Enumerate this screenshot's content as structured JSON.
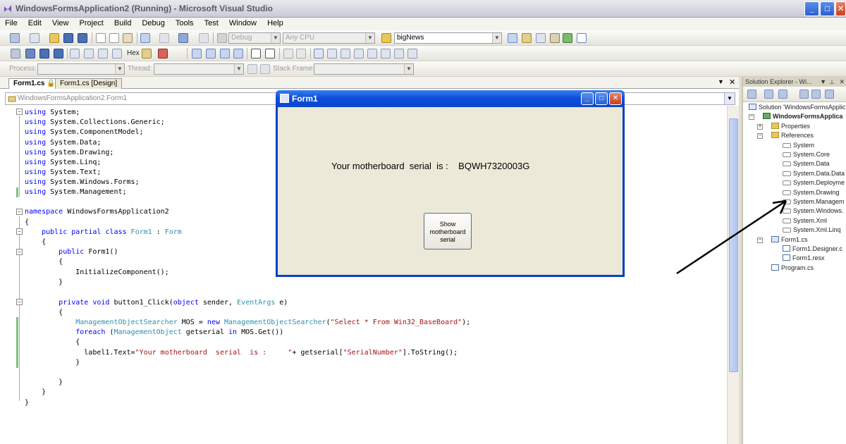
{
  "window": {
    "title": "WindowsFormsApplication2 (Running) - Microsoft Visual Studio",
    "min": "_",
    "max": "□",
    "close": "✕"
  },
  "menu": [
    "File",
    "Edit",
    "View",
    "Project",
    "Build",
    "Debug",
    "Tools",
    "Test",
    "Window",
    "Help"
  ],
  "toolbar": {
    "config": "Debug",
    "platform": "Any CPU",
    "find_value": "bigNews",
    "hex_label": "Hex",
    "process_label": "Process:",
    "thread_label": "Thread:",
    "stackframe_label": "Stack Frame:"
  },
  "tabs": [
    {
      "label": "Form1.cs",
      "active": true
    },
    {
      "label": "Form1.cs [Design]",
      "active": false
    }
  ],
  "type_dropdown": "WindowsFormsApplication2.Form1",
  "code": [
    [
      [
        "kw",
        "using"
      ],
      [
        "plain",
        " System;"
      ]
    ],
    [
      [
        "kw",
        "using"
      ],
      [
        "plain",
        " System.Collections.Generic;"
      ]
    ],
    [
      [
        "kw",
        "using"
      ],
      [
        "plain",
        " System.ComponentModel;"
      ]
    ],
    [
      [
        "kw",
        "using"
      ],
      [
        "plain",
        " System.Data;"
      ]
    ],
    [
      [
        "kw",
        "using"
      ],
      [
        "plain",
        " System.Drawing;"
      ]
    ],
    [
      [
        "kw",
        "using"
      ],
      [
        "plain",
        " System.Linq;"
      ]
    ],
    [
      [
        "kw",
        "using"
      ],
      [
        "plain",
        " System.Text;"
      ]
    ],
    [
      [
        "kw",
        "using"
      ],
      [
        "plain",
        " System.Windows.Forms;"
      ]
    ],
    [
      [
        "kw",
        "using"
      ],
      [
        "plain",
        " System.Management;"
      ]
    ],
    [],
    [
      [
        "kw",
        "namespace"
      ],
      [
        "plain",
        " WindowsFormsApplication2"
      ]
    ],
    [
      [
        "plain",
        "{"
      ]
    ],
    [
      [
        "plain",
        "    "
      ],
      [
        "kw",
        "public partial class"
      ],
      [
        "plain",
        " "
      ],
      [
        "ty",
        "Form1"
      ],
      [
        "plain",
        " : "
      ],
      [
        "ty",
        "Form"
      ]
    ],
    [
      [
        "plain",
        "    {"
      ]
    ],
    [
      [
        "plain",
        "        "
      ],
      [
        "kw",
        "public"
      ],
      [
        "plain",
        " Form1()"
      ]
    ],
    [
      [
        "plain",
        "        {"
      ]
    ],
    [
      [
        "plain",
        "            InitializeComponent();"
      ]
    ],
    [
      [
        "plain",
        "        }"
      ]
    ],
    [],
    [
      [
        "plain",
        "        "
      ],
      [
        "kw",
        "private void"
      ],
      [
        "plain",
        " button1_Click("
      ],
      [
        "kw",
        "object"
      ],
      [
        "plain",
        " sender, "
      ],
      [
        "ty",
        "EventArgs"
      ],
      [
        "plain",
        " e)"
      ]
    ],
    [
      [
        "plain",
        "        {"
      ]
    ],
    [
      [
        "plain",
        "            "
      ],
      [
        "ty",
        "ManagementObjectSearcher"
      ],
      [
        "plain",
        " MOS = "
      ],
      [
        "kw",
        "new"
      ],
      [
        "plain",
        " "
      ],
      [
        "ty",
        "ManagementObjectSearcher"
      ],
      [
        "plain",
        "("
      ],
      [
        "st",
        "\"Select * From Win32_BaseBoard\""
      ],
      [
        "plain",
        ");"
      ]
    ],
    [
      [
        "plain",
        "            "
      ],
      [
        "kw",
        "foreach"
      ],
      [
        "plain",
        " ("
      ],
      [
        "ty",
        "ManagementObject"
      ],
      [
        "plain",
        " getserial "
      ],
      [
        "kw",
        "in"
      ],
      [
        "plain",
        " MOS.Get())"
      ]
    ],
    [
      [
        "plain",
        "            {"
      ]
    ],
    [
      [
        "plain",
        "              label1.Text="
      ],
      [
        "st",
        "\"Your motherboard  serial  is :     \""
      ],
      [
        "plain",
        "+ getserial["
      ],
      [
        "st",
        "\"SerialNumber\""
      ],
      [
        "plain",
        "].ToString();"
      ]
    ],
    [
      [
        "plain",
        "            }"
      ]
    ],
    [],
    [
      [
        "plain",
        "        }"
      ]
    ],
    [
      [
        "plain",
        "    }"
      ]
    ],
    [
      [
        "plain",
        "}"
      ]
    ]
  ],
  "form1": {
    "title": "Form1",
    "label_text": "Your motherboard  serial  is :    BQWH7320003G",
    "button_label": "Show\nmotherboard\nserial"
  },
  "solution_explorer": {
    "title": "Solution Explorer - Wi...",
    "items": [
      {
        "label": "Solution 'WindowsFormsApplic",
        "level": 0,
        "icon": "solution-icon"
      },
      {
        "label": "WindowsFormsApplica",
        "level": 1,
        "icon": "project-icon",
        "bold": true,
        "exp": "−"
      },
      {
        "label": "Properties",
        "level": 2,
        "icon": "folder-icon",
        "exp": "+"
      },
      {
        "label": "References",
        "level": 2,
        "icon": "folder-icon",
        "exp": "−"
      },
      {
        "label": "System",
        "level": 3,
        "icon": "reference-icon"
      },
      {
        "label": "System.Core",
        "level": 3,
        "icon": "reference-icon"
      },
      {
        "label": "System.Data",
        "level": 3,
        "icon": "reference-icon"
      },
      {
        "label": "System.Data.Data",
        "level": 3,
        "icon": "reference-icon"
      },
      {
        "label": "System.Deployme",
        "level": 3,
        "icon": "reference-icon"
      },
      {
        "label": "System.Drawing",
        "level": 3,
        "icon": "reference-icon"
      },
      {
        "label": "System.Managem",
        "level": 3,
        "icon": "reference-icon"
      },
      {
        "label": "System.Windows.",
        "level": 3,
        "icon": "reference-icon"
      },
      {
        "label": "System.Xml",
        "level": 3,
        "icon": "reference-icon"
      },
      {
        "label": "System.Xml.Linq",
        "level": 3,
        "icon": "reference-icon"
      },
      {
        "label": "Form1.cs",
        "level": 2,
        "icon": "form-icon",
        "exp": "−"
      },
      {
        "label": "Form1.Designer.c",
        "level": 3,
        "icon": "cs-icon"
      },
      {
        "label": "Form1.resx",
        "level": 3,
        "icon": "resx-icon"
      },
      {
        "label": "Program.cs",
        "level": 2,
        "icon": "cs-icon"
      }
    ]
  },
  "colors": {
    "keyword": "#0000ff",
    "type": "#2b91af",
    "string": "#a31515",
    "xp_blue": "#0a46cc"
  }
}
